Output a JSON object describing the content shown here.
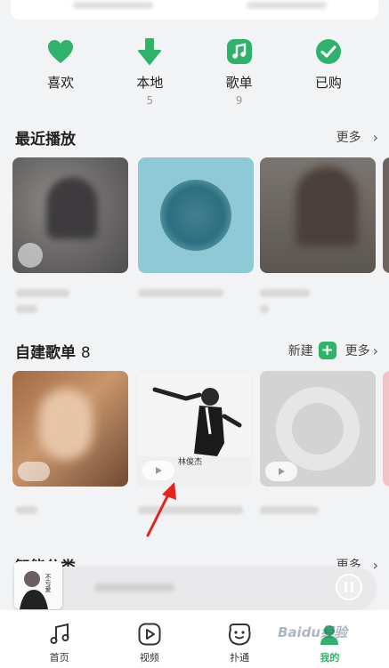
{
  "colors": {
    "accent": "#2fb36b",
    "background": "#f2f3f5",
    "arrow": "#e8211c"
  },
  "quick_access": [
    {
      "label": "喜欢",
      "count": "",
      "icon": "heart-icon"
    },
    {
      "label": "本地",
      "count": "5",
      "icon": "download-arrow-icon"
    },
    {
      "label": "歌单",
      "count": "9",
      "icon": "music-note-icon"
    },
    {
      "label": "已购",
      "count": "",
      "icon": "check-circle-icon"
    }
  ],
  "recent": {
    "title": "最近播放",
    "more_label": "更多"
  },
  "playlists": {
    "title": "自建歌单",
    "count": "8",
    "new_label": "新建",
    "more_label": "更多",
    "album_text": "林俊杰"
  },
  "smart": {
    "title": "智能分类",
    "more_label": "更多"
  },
  "mini_player": {
    "art_text": "不亏爱"
  },
  "nav": {
    "items": [
      {
        "label": "首页",
        "icon": "music-note-icon"
      },
      {
        "label": "视频",
        "icon": "play-square-icon"
      },
      {
        "label": "扑通",
        "icon": "smile-face-icon"
      },
      {
        "label": "我的",
        "icon": "profile-icon"
      }
    ]
  },
  "watermark": "Baidu经验"
}
